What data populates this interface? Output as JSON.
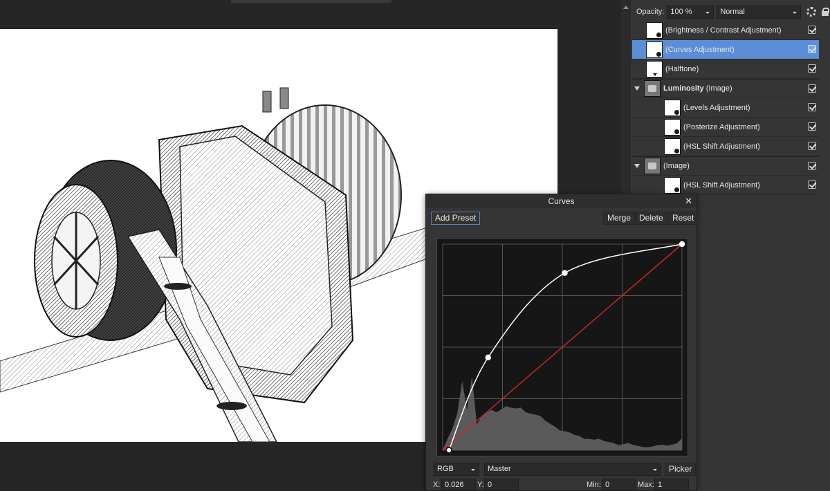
{
  "layers_panel": {
    "opacity_label": "Opacity:",
    "opacity_value": "100 %",
    "blend_mode": "Normal",
    "layers": [
      {
        "name": "(Brightness / Contrast Adjustment)",
        "checked": true
      },
      {
        "name": "(Curves Adjustment)",
        "checked": true,
        "selected": true
      },
      {
        "name": "(Halftone)",
        "checked": true
      },
      {
        "name_bold": "Luminosity",
        "name": "(Image)",
        "checked": true,
        "group": true
      },
      {
        "name": "(Levels Adjustment)",
        "checked": true
      },
      {
        "name": "(Posterize Adjustment)",
        "checked": true
      },
      {
        "name": "(HSL Shift Adjustment)",
        "checked": true
      },
      {
        "name": "(Image)",
        "checked": true,
        "group": true
      },
      {
        "name": "(HSL Shift Adjustment)",
        "checked": true
      }
    ]
  },
  "curves": {
    "title": "Curves",
    "add_preset": "Add Preset",
    "merge": "Merge",
    "delete": "Delete",
    "reset": "Reset",
    "channel_space": "RGB",
    "channel": "Master",
    "picker": "Picker",
    "x_label": "X:",
    "x_value": "0.026",
    "y_label": "Y:",
    "y_value": "0",
    "min_label": "Min:",
    "min_value": "0",
    "max_label": "Max:",
    "max_value": "1",
    "control_points": [
      [
        0.026,
        0.0
      ],
      [
        0.19,
        0.45
      ],
      [
        0.51,
        0.86
      ],
      [
        1.0,
        1.0
      ]
    ],
    "colors": {
      "curve": "#ffffff",
      "identity": "#c62828",
      "histogram": "#5a5a5a",
      "grid": "#555555"
    }
  }
}
